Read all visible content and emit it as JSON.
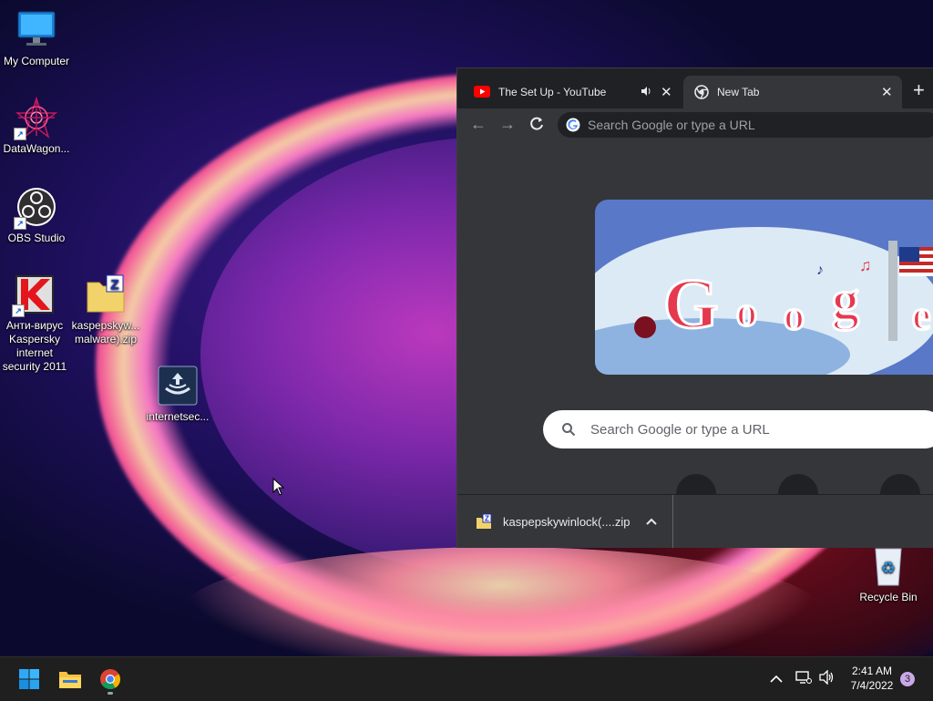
{
  "desktop": {
    "icons": [
      {
        "label": "My Computer"
      },
      {
        "label": "DataWagon..."
      },
      {
        "label": "OBS Studio"
      },
      {
        "label": "Анти-вирус Kaspersky internet security 2011"
      },
      {
        "label": "kaspepskyw... malware).zip"
      },
      {
        "label": "internetsec..."
      },
      {
        "label": "Recycle Bin"
      }
    ]
  },
  "browser": {
    "tabs": [
      {
        "title": "The Set Up - YouTube",
        "icon": "youtube-icon",
        "audio": true
      },
      {
        "title": "New Tab",
        "icon": "chrome-icon",
        "active": true
      }
    ],
    "omnibox": {
      "placeholder": "Search Google or type a URL"
    },
    "ntp": {
      "doodle_text": "Google",
      "search_placeholder": "Search Google or type a URL"
    },
    "download": {
      "filename": "kaspepskywinlock(....zip"
    }
  },
  "taskbar": {
    "pinned": [
      "start-button",
      "file-explorer",
      "chrome"
    ],
    "clock": {
      "time": "2:41 AM",
      "date": "7/4/2022"
    },
    "notification_count": "3"
  },
  "colors": {
    "chrome_dark": "#202124",
    "chrome_toolbar": "#35363a",
    "doodle_bg": "#5a78c8",
    "notification_badge": "#c9a9e8"
  }
}
